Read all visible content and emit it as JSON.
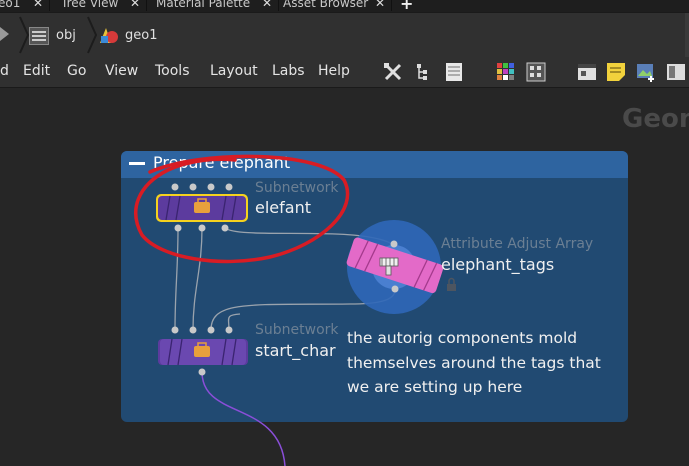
{
  "tabs": [
    {
      "label": "eo1"
    },
    {
      "label": "Tree View"
    },
    {
      "label": "Material Palette"
    },
    {
      "label": "Asset Browser"
    }
  ],
  "path": {
    "obj_label": "obj",
    "geo_label": "geo1"
  },
  "menu": {
    "items": [
      "d",
      "Edit",
      "Go",
      "View",
      "Tools",
      "Layout",
      "Labs",
      "Help"
    ]
  },
  "network": {
    "context_label": "Geom",
    "netbox_title": "Prepare elephant",
    "nodes": [
      {
        "type": "Subnetwork",
        "name": "elefant"
      },
      {
        "type": "Attribute Adjust Array",
        "name": "elephant_tags"
      },
      {
        "type": "Subnetwork",
        "name": "start_char"
      }
    ],
    "sticky_note": "the autorig components mold themselves around the tags that we are setting up here"
  },
  "colors": {
    "netbox_bg": "#214a72",
    "netbox_header": "#2e64a0",
    "subnet_node": "#5c3b9e",
    "selected_outline": "#f5d21e",
    "attribute_node": "#e36ac8",
    "annotation_circle": "#d81c24"
  },
  "icons": [
    "obj-icon",
    "geo-icon",
    "tool-icons",
    "toolbox-icon",
    "lock-icon"
  ]
}
